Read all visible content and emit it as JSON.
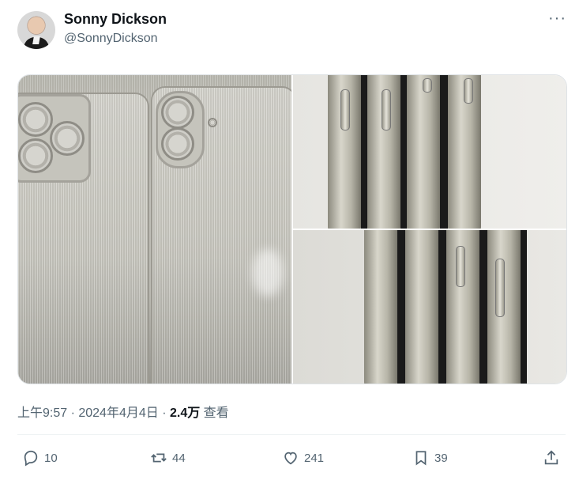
{
  "author": {
    "name": "Sonny Dickson",
    "handle": "@SonnyDickson"
  },
  "menu": {
    "more_icon": "more-horizontal-icon",
    "more_label": "···"
  },
  "tweet": {
    "timestamp": "上午9:57 · 2024年4月4日 · ",
    "views_count": "2.4万",
    "views_label": " 查看"
  },
  "actions": {
    "replies": "10",
    "retweets": "44",
    "likes": "241",
    "bookmarks": "39"
  },
  "colors": {
    "text": "#0f1419",
    "muted": "#536471",
    "divider": "#eff3f4"
  }
}
